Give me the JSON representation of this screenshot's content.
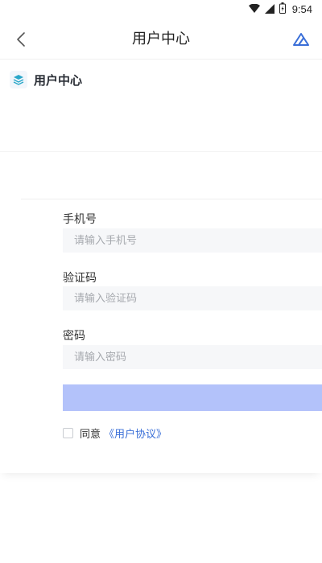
{
  "status_bar": {
    "time": "9:54",
    "icons": [
      "wifi-icon",
      "signal-icon",
      "battery-icon"
    ]
  },
  "nav": {
    "title": "用户中心",
    "back_icon": "chevron-left-icon",
    "right_icon": "triangle-logo-icon"
  },
  "section": {
    "title": "用户中心",
    "icon": "layers-icon"
  },
  "form": {
    "phone": {
      "label": "手机号",
      "placeholder": "请输入手机号",
      "value": ""
    },
    "code": {
      "label": "验证码",
      "placeholder": "请输入验证码",
      "value": ""
    },
    "password": {
      "label": "密码",
      "placeholder": "请输入密码",
      "value": ""
    },
    "submit_label": "",
    "agree": {
      "text": "同意",
      "link": "《用户协议》",
      "checked": false
    }
  },
  "colors": {
    "accent": "#3a6fd8",
    "submit_button": "#b3c2fa",
    "input_background": "#f6f7f9",
    "section_icon": "#2aa7c9"
  }
}
